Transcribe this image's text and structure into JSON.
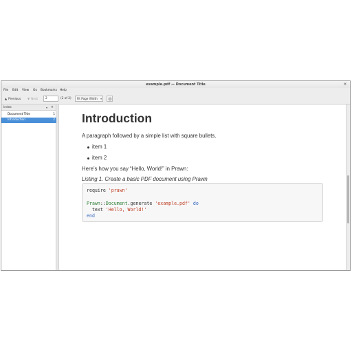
{
  "window": {
    "title": "example.pdf — Document Title"
  },
  "menu": [
    "File",
    "Edit",
    "View",
    "Go",
    "Bookmarks",
    "Help"
  ],
  "toolbar": {
    "previous_label": "Previous",
    "next_label": "Next",
    "page_value": "2",
    "page_count": "(2 of 2)",
    "zoom_value": "Fit Page Width"
  },
  "sidebar": {
    "title": "Index",
    "items": [
      {
        "label": "Document Title",
        "page": "1",
        "selected": false
      },
      {
        "label": "Introduction",
        "page": "2",
        "selected": true
      }
    ]
  },
  "document": {
    "heading": "Introduction",
    "paragraph": "A paragraph followed by a simple list with square bullets.",
    "list": [
      "item 1",
      "item 2"
    ],
    "paragraph2": "Here’s how you say “Hello, World!” in Prawn:",
    "caption": "Listing 1. Create a basic PDF document using Prawn",
    "code": {
      "l1_a": "require ",
      "l1_b": "'prawn'",
      "l3_a": "Prawn",
      "l3_b": "::",
      "l3_c": "Document",
      "l3_d": ".generate ",
      "l3_e": "'example.pdf'",
      "l3_f": " do",
      "l4_a": "  text ",
      "l4_b": "'Hello, World!'",
      "l5": "end"
    }
  },
  "colors": {
    "selection": "#4a90d9",
    "string": "#c03f24",
    "keyword": "#3366bb",
    "class": "#2e7d32"
  }
}
